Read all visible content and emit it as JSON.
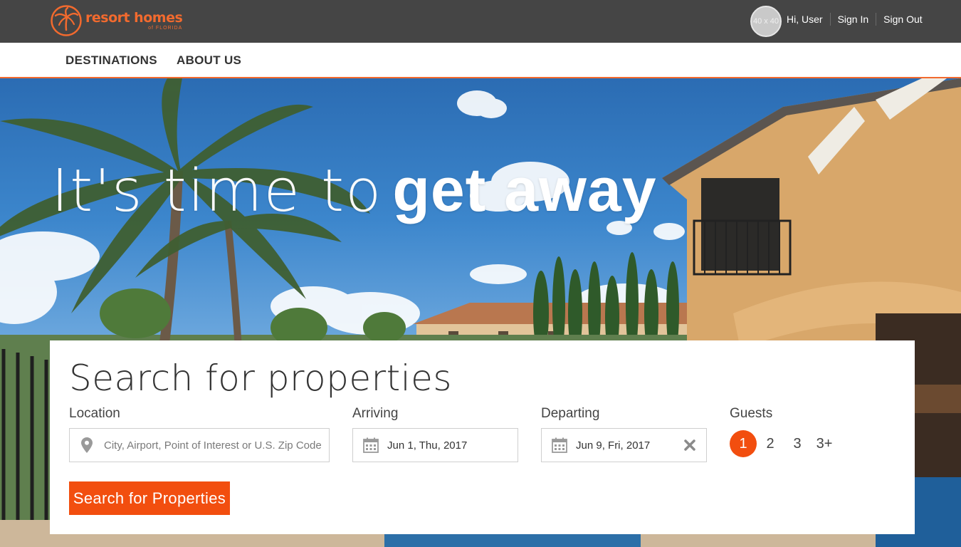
{
  "brand": {
    "name": "resort homes",
    "sub": "of FLORIDA",
    "accent": "#f26a2e"
  },
  "user": {
    "avatar_placeholder": "40 x 40",
    "greeting": "Hi, User",
    "sign_in": "Sign In",
    "sign_out": "Sign Out"
  },
  "nav": {
    "items": [
      {
        "label": "DESTINATIONS"
      },
      {
        "label": "ABOUT US"
      }
    ]
  },
  "hero": {
    "headline_light": "It's time to",
    "headline_bold": "get away"
  },
  "search": {
    "title": "Search for properties",
    "location": {
      "label": "Location",
      "placeholder": "City, Airport, Point of Interest or U.S. Zip Code",
      "value": ""
    },
    "arriving": {
      "label": "Arriving",
      "value": "Jun 1, Thu, 2017"
    },
    "departing": {
      "label": "Departing",
      "value": "Jun 9, Fri, 2017"
    },
    "guests": {
      "label": "Guests",
      "options": [
        "1",
        "2",
        "3",
        "3+"
      ],
      "selected": "1"
    },
    "button_label": "Search for Properties"
  },
  "colors": {
    "topbar": "#454545",
    "button": "#f24e0f",
    "active_guest": "#f24e0f"
  },
  "icons": {
    "location": "map-pin-icon",
    "date": "calendar-icon",
    "clear": "close-icon"
  }
}
